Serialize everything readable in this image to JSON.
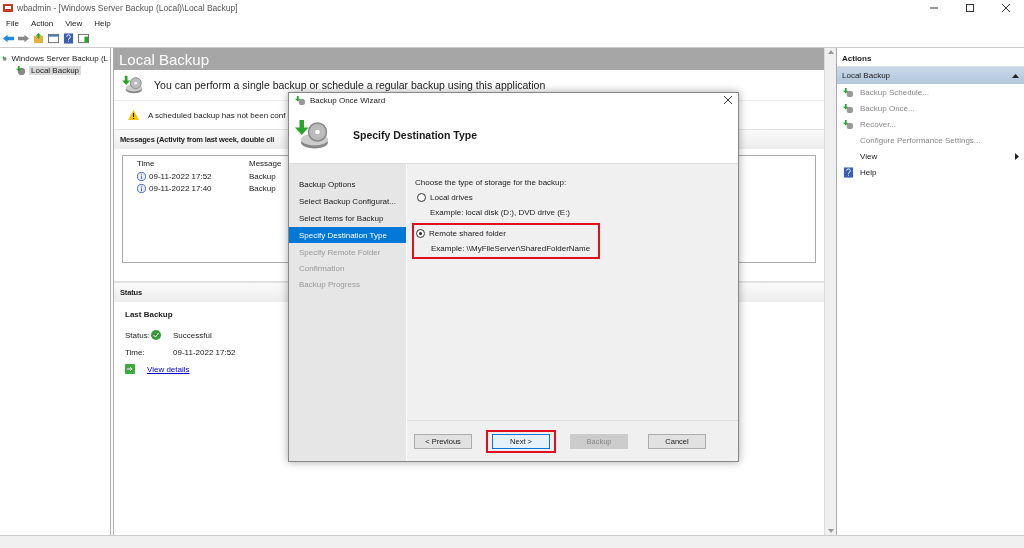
{
  "window": {
    "title": "wbadmin - [Windows Server Backup (Local)\\Local Backup]"
  },
  "menu": [
    "File",
    "Action",
    "View",
    "Help"
  ],
  "tree": [
    {
      "label": "Windows Server Backup (L",
      "selected": false,
      "children": [
        {
          "label": "Local Backup",
          "selected": true
        }
      ]
    }
  ],
  "main": {
    "title": "Local Backup",
    "intro": "You can perform a single backup or schedule a regular backup using this application",
    "warning": "A scheduled backup has not been conf",
    "messages": {
      "heading": "Messages (Activity from last week, double cli",
      "columns": [
        "Time",
        "Message"
      ],
      "rows": [
        {
          "time": "09-11-2022 17:52",
          "message": "Backup"
        },
        {
          "time": "09-11-2022 17:40",
          "message": "Backup"
        }
      ]
    },
    "status": {
      "heading": "Status",
      "subheading": "Last Backup",
      "fields": [
        {
          "label": "Status:",
          "value": "Successful",
          "kind": "success"
        },
        {
          "label": "Time:",
          "value": "09-11-2022 17:52",
          "kind": "plain"
        }
      ],
      "link": "View details"
    }
  },
  "dialog": {
    "title": "Backup Once Wizard",
    "heading": "Specify Destination Type",
    "steps": [
      {
        "label": "Backup Options",
        "selected": false,
        "disabled": false
      },
      {
        "label": "Select Backup Configurat...",
        "selected": false,
        "disabled": false
      },
      {
        "label": "Select Items for Backup",
        "selected": false,
        "disabled": false
      },
      {
        "label": "Specify Destination Type",
        "selected": true,
        "disabled": false
      },
      {
        "label": "Specify Remote Folder",
        "selected": false,
        "disabled": true
      },
      {
        "label": "Confirmation",
        "selected": false,
        "disabled": true
      },
      {
        "label": "Backup Progress",
        "selected": false,
        "disabled": true
      }
    ],
    "prompt": "Choose the type of storage for the backup:",
    "options": [
      {
        "label": "Local drives",
        "example": "Example: local disk (D:), DVD drive (E:)",
        "selected": false,
        "highlighted": false
      },
      {
        "label": "Remote shared folder",
        "example": "Example: \\\\MyFileServer\\SharedFolderName",
        "selected": true,
        "highlighted": true
      }
    ],
    "buttons": [
      {
        "label": "< Previous",
        "disabled": false,
        "highlighted": false,
        "focused": false
      },
      {
        "label": "Next >",
        "disabled": false,
        "highlighted": true,
        "focused": true
      },
      {
        "label": "Backup",
        "disabled": true,
        "highlighted": false,
        "focused": false
      },
      {
        "label": "Cancel",
        "disabled": false,
        "highlighted": false,
        "focused": false
      }
    ]
  },
  "actions": {
    "heading": "Actions",
    "group": "Local Backup",
    "items": [
      {
        "label": "Backup Schedule...",
        "kind": "schedule",
        "disabled": true
      },
      {
        "label": "Backup Once...",
        "kind": "once",
        "disabled": true
      },
      {
        "label": "Recover...",
        "kind": "recover",
        "disabled": true
      },
      {
        "label": "Configure Performance Settings...",
        "kind": "plain",
        "disabled": true
      },
      {
        "label": "View",
        "kind": "submenu",
        "disabled": false
      },
      {
        "label": "Help",
        "kind": "help",
        "disabled": false
      }
    ]
  }
}
